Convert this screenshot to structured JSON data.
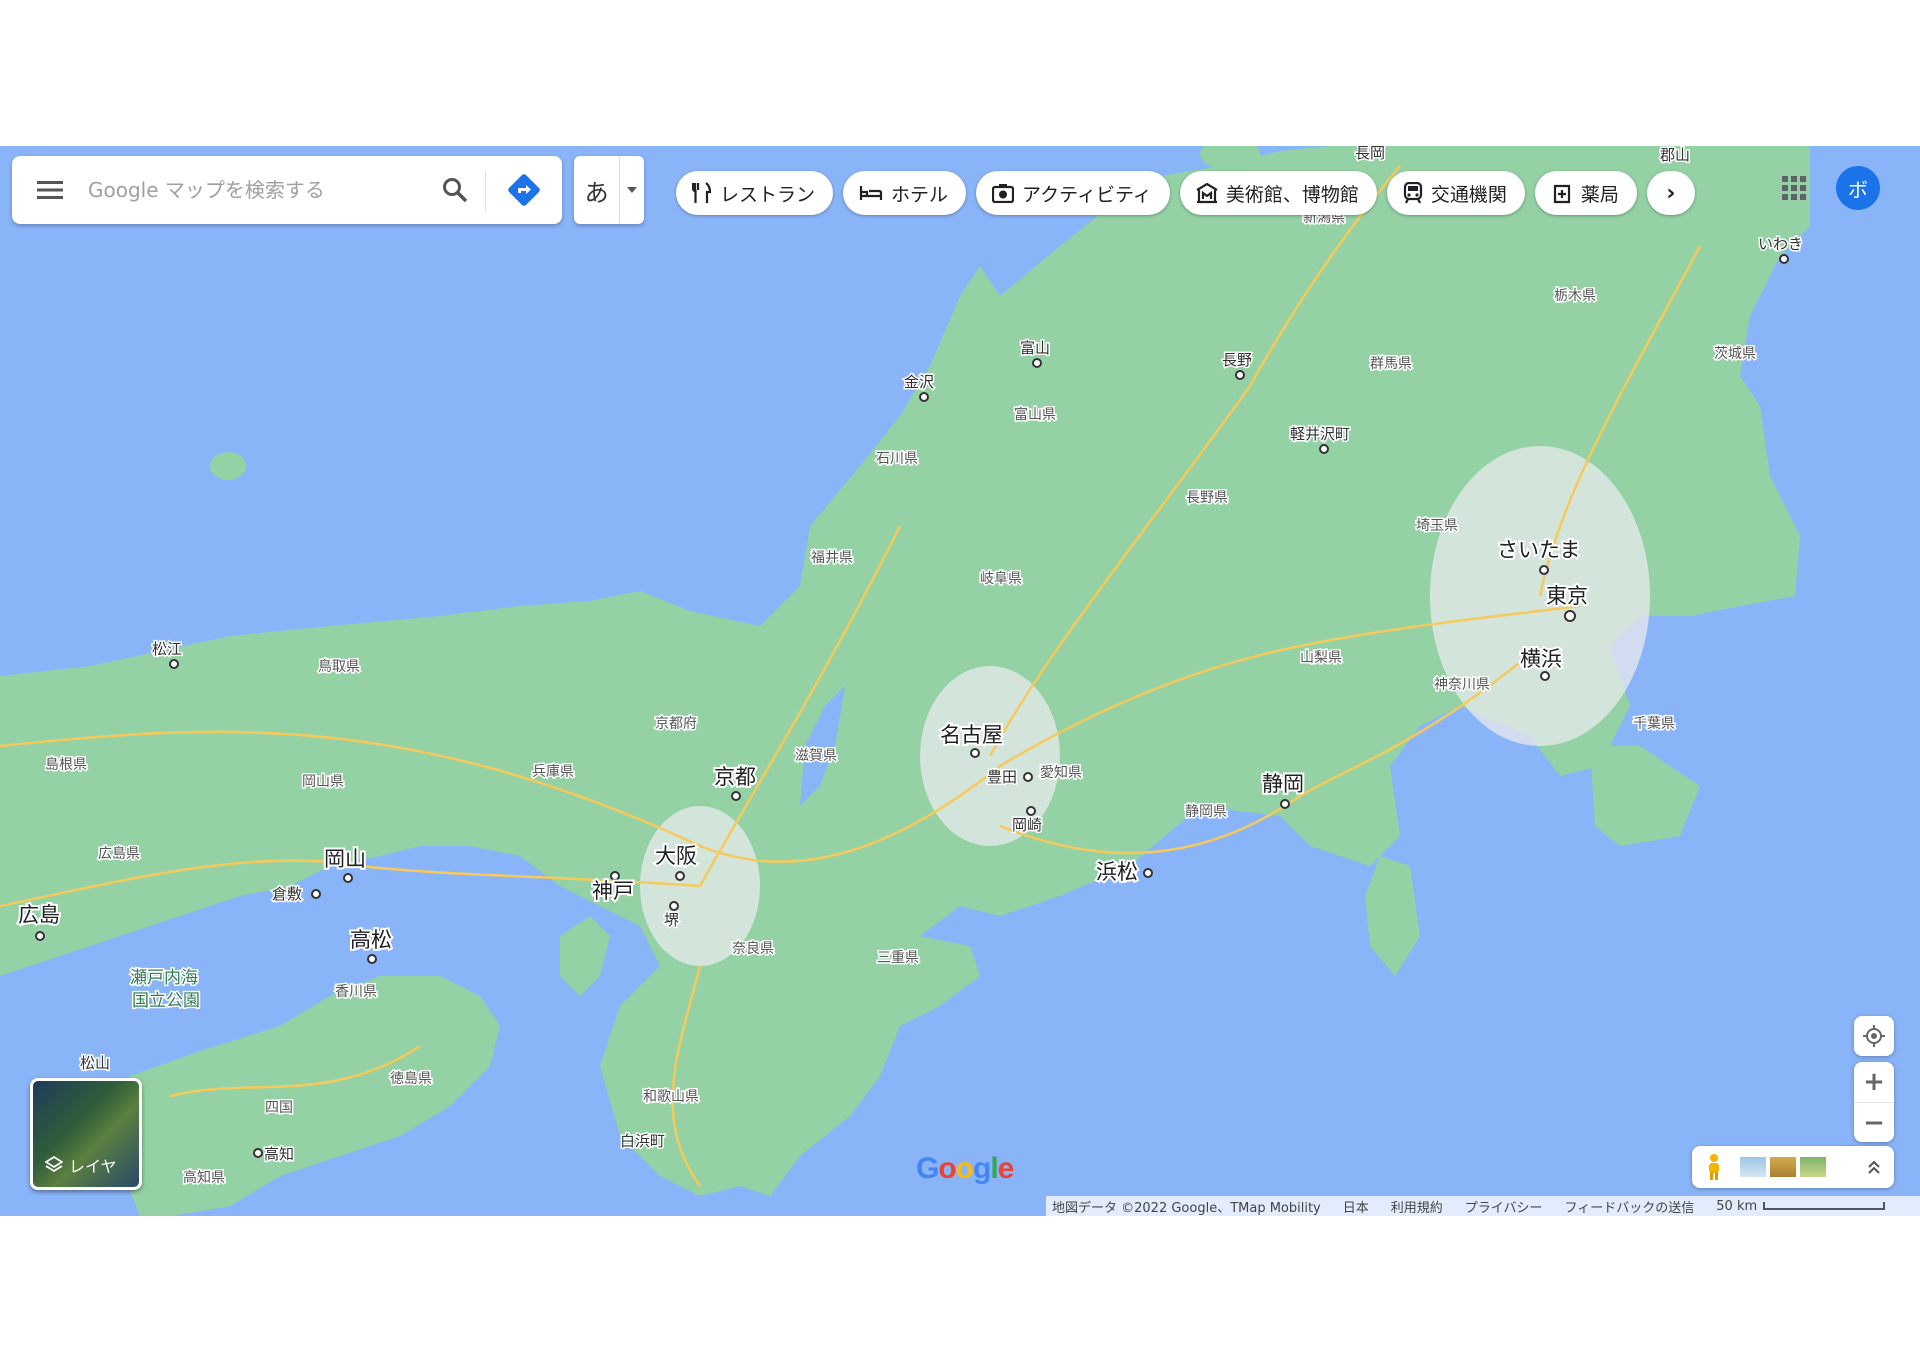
{
  "search": {
    "placeholder": "Google マップを検索する"
  },
  "ime": {
    "char": "あ"
  },
  "chips": [
    {
      "label": "レストラン",
      "icon": "restaurant-icon"
    },
    {
      "label": "ホテル",
      "icon": "hotel-icon"
    },
    {
      "label": "アクティビティ",
      "icon": "activity-icon"
    },
    {
      "label": "美術館、博物館",
      "icon": "museum-icon"
    },
    {
      "label": "交通機関",
      "icon": "transit-icon"
    },
    {
      "label": "薬局",
      "icon": "pharmacy-icon"
    }
  ],
  "chips_next": "›",
  "avatar": {
    "initial": "ボ"
  },
  "layers": {
    "label": "レイヤ"
  },
  "zoom": {
    "in": "+",
    "out": "−"
  },
  "attribution": {
    "data": "地図データ ©2022 Google、TMap Mobility",
    "country": "日本",
    "terms": "利用規約",
    "privacy": "プライバシー",
    "feedback": "フィードバックの送信",
    "scale": "50 km"
  },
  "logo": {
    "letters": [
      "G",
      "o",
      "o",
      "g",
      "l",
      "e"
    ]
  },
  "colors": {
    "water": "#8ab4f8",
    "land": "#94d2a5",
    "urban": "#e8eaed",
    "road": "#f6c95b",
    "accent": "#1a73e8"
  },
  "cities_major": [
    "名古屋",
    "京都",
    "大阪",
    "神戸",
    "東京",
    "横浜",
    "さいたま",
    "静岡",
    "浜松",
    "岡山",
    "広島",
    "高松"
  ],
  "cities": [
    "豊田",
    "岡崎",
    "堺",
    "倉敷",
    "松江",
    "金沢",
    "富山",
    "長野",
    "軽井沢町",
    "いわき",
    "長岡",
    "郡山",
    "松山",
    "高知",
    "白浜町"
  ],
  "prefectures": [
    "鳥取県",
    "島根県",
    "岡山県",
    "広島県",
    "兵庫県",
    "京都府",
    "滋賀県",
    "福井県",
    "石川県",
    "富山県",
    "岐阜県",
    "愛知県",
    "三重県",
    "奈良県",
    "和歌山県",
    "長野県",
    "山梨県",
    "静岡県",
    "神奈川県",
    "埼玉県",
    "群馬県",
    "栃木県",
    "茨城県",
    "千葉県",
    "香川県",
    "徳島県",
    "高知県",
    "四国",
    "新潟県"
  ],
  "park": [
    "瀬戸内海",
    "国立公園"
  ]
}
